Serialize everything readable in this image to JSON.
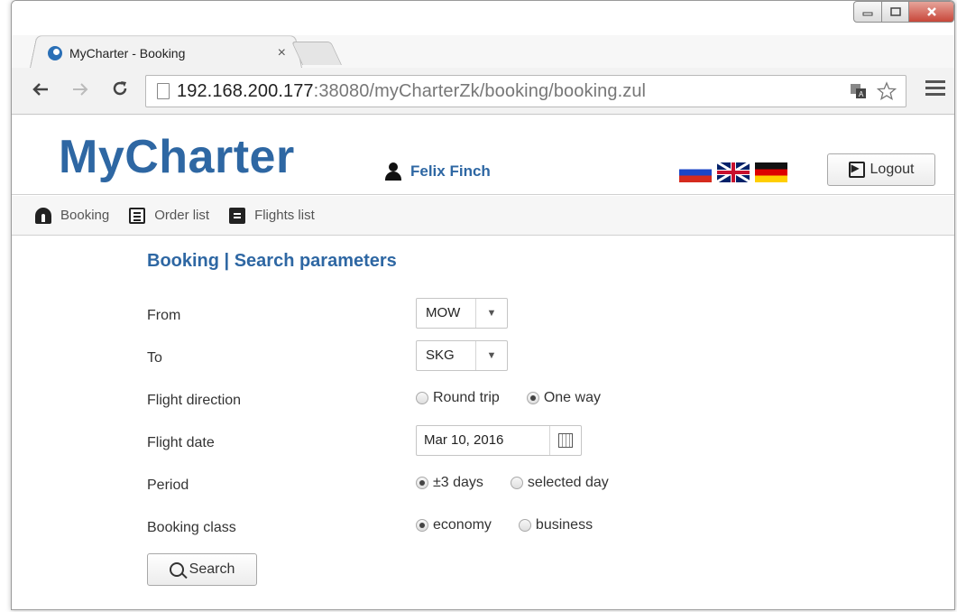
{
  "browser": {
    "tab_title": "MyCharter - Booking",
    "tab_close": "×",
    "url_host": "192.168.200.177",
    "url_path": ":38080/myCharterZk/booking/booking.zul",
    "window_controls": [
      "user",
      "minimize",
      "maximize",
      "close"
    ]
  },
  "header": {
    "brand": "MyCharter",
    "user_name": "Felix Finch",
    "flags": [
      "ru",
      "uk",
      "de"
    ],
    "logout_label": "Logout"
  },
  "menu": {
    "items": [
      {
        "label": "Booking",
        "icon": "booking-icon"
      },
      {
        "label": "Order list",
        "icon": "list-icon"
      },
      {
        "label": "Flights list",
        "icon": "flights-icon"
      }
    ]
  },
  "form": {
    "title": "Booking | Search parameters",
    "from": {
      "label": "From",
      "value": "MOW"
    },
    "to": {
      "label": "To",
      "value": "SKG"
    },
    "direction": {
      "label": "Flight direction",
      "options": [
        "Round trip",
        "One way"
      ],
      "selected": "One way"
    },
    "date": {
      "label": "Flight date",
      "value": "Mar 10, 2016"
    },
    "period": {
      "label": "Period",
      "options": [
        "±3 days",
        "selected day"
      ],
      "selected": "±3 days"
    },
    "class": {
      "label": "Booking class",
      "options": [
        "economy",
        "business"
      ],
      "selected": "economy"
    },
    "search_label": "Search"
  }
}
